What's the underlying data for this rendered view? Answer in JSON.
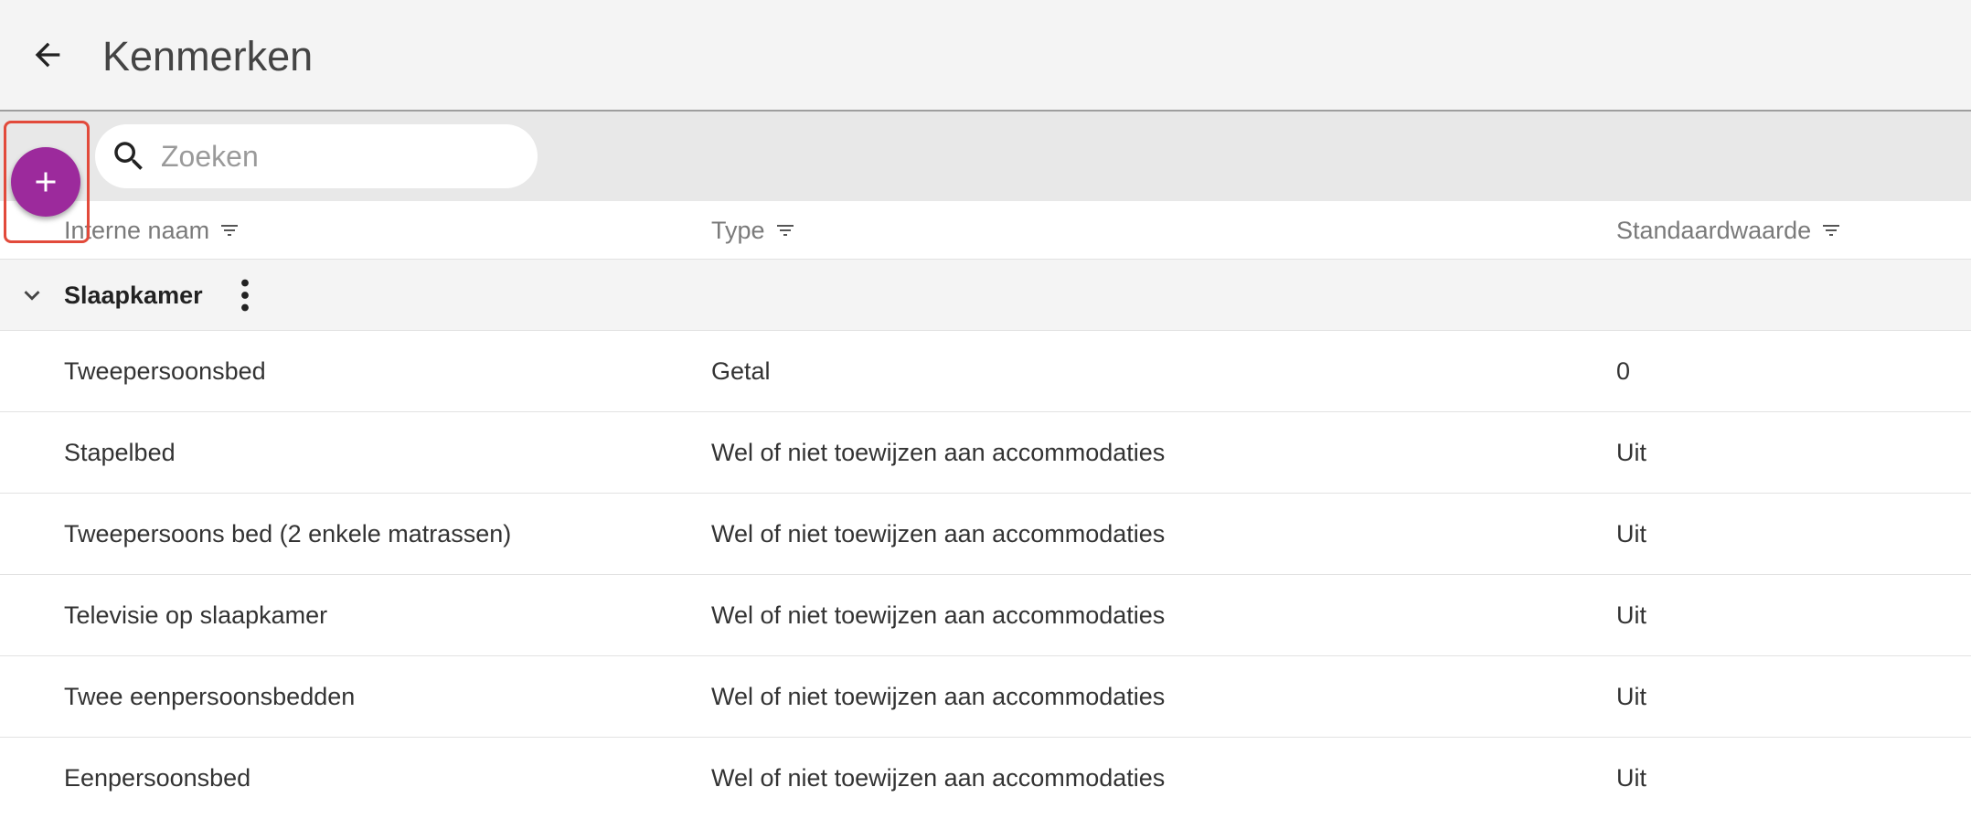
{
  "header": {
    "title": "Kenmerken",
    "back_icon": "arrow-left-icon"
  },
  "toolbar": {
    "add_icon": "plus-icon",
    "search": {
      "placeholder": "Zoeken",
      "value": "",
      "icon": "search-icon"
    }
  },
  "table": {
    "columns": [
      {
        "label": "Interne naam",
        "icon": "filter-icon"
      },
      {
        "label": "Type",
        "icon": "filter-icon"
      },
      {
        "label": "Standaardwaarde",
        "icon": "filter-icon"
      }
    ],
    "group": {
      "name": "Slaapkamer",
      "expand_icon": "chevron-down-icon",
      "menu_icon": "more-vertical-icon"
    },
    "rows": [
      {
        "name": "Tweepersoonsbed",
        "type": "Getal",
        "default": "0"
      },
      {
        "name": "Stapelbed",
        "type": "Wel of niet toewijzen aan accommodaties",
        "default": "Uit"
      },
      {
        "name": "Tweepersoons bed (2 enkele matrassen)",
        "type": "Wel of niet toewijzen aan accommodaties",
        "default": "Uit"
      },
      {
        "name": "Televisie op slaapkamer",
        "type": "Wel of niet toewijzen aan accommodaties",
        "default": "Uit"
      },
      {
        "name": "Twee eenpersoonsbedden",
        "type": "Wel of niet toewijzen aan accommodaties",
        "default": "Uit"
      },
      {
        "name": "Eenpersoonsbed",
        "type": "Wel of niet toewijzen aan accommodaties",
        "default": "Uit"
      }
    ]
  },
  "colors": {
    "accent": "#9c2a9c",
    "highlight": "#e24a3b",
    "header_bg": "#f4f4f4",
    "toolbar_bg": "#e8e8e8"
  }
}
